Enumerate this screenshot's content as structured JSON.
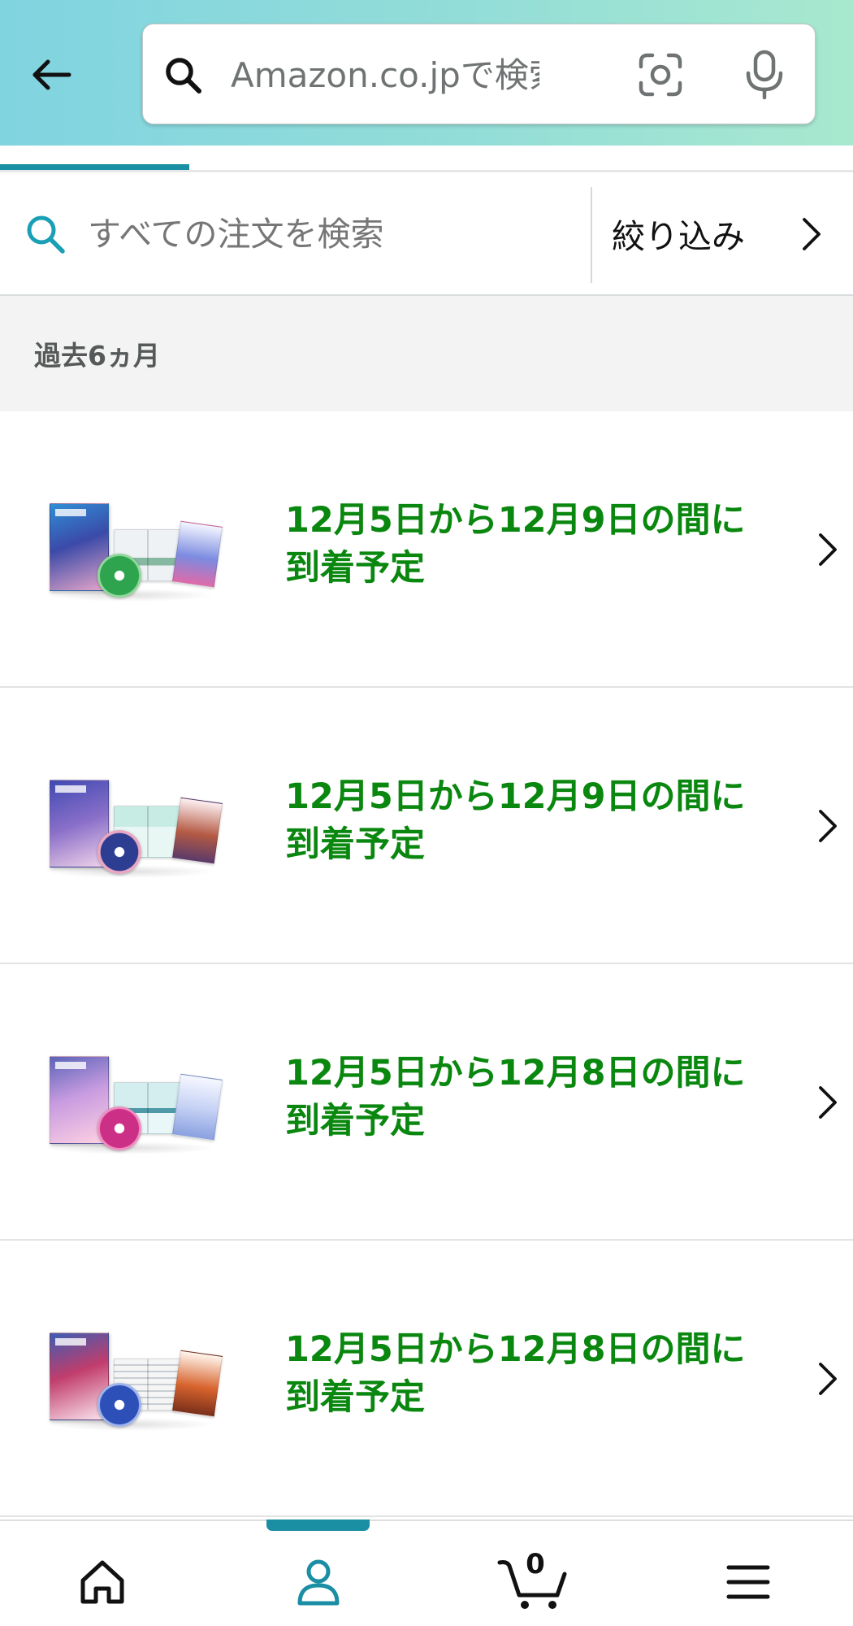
{
  "header": {
    "search_placeholder": "Amazon.co.jpで検索",
    "back_icon": "arrow-left-icon",
    "search_icon": "search-icon",
    "camera_icon": "camera-lens-icon",
    "mic_icon": "microphone-icon"
  },
  "order_search": {
    "placeholder": "すべての注文を検索",
    "filter_label": "絞り込み",
    "search_icon": "search-icon",
    "filter_icon": "chevron-right-icon"
  },
  "period": {
    "label": "過去6ヵ月"
  },
  "orders": [
    {
      "delivery_text": "12月5日から12月9日の間に到着予定"
    },
    {
      "delivery_text": "12月5日から12月9日の間に到着予定"
    },
    {
      "delivery_text": "12月5日から12月8日の間に到着予定"
    },
    {
      "delivery_text": "12月5日から12月8日の間に到着予定"
    }
  ],
  "bottom_nav": {
    "items": [
      {
        "icon": "home-icon",
        "active": false
      },
      {
        "icon": "person-icon",
        "active": true
      },
      {
        "icon": "cart-icon",
        "active": false
      },
      {
        "icon": "menu-icon",
        "active": false
      }
    ],
    "cart_count": "0"
  },
  "colors": {
    "accent": "#1a8ea3",
    "delivery_green": "#0a870f",
    "header_gradient_start": "#80d4e0",
    "header_gradient_end": "#a8e8cf",
    "section_background": "#f3f3f3"
  }
}
